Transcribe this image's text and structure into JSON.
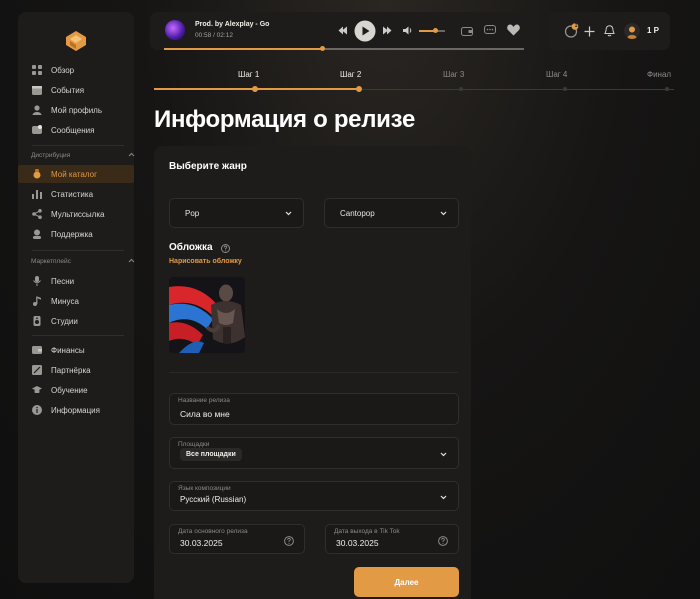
{
  "sidebar": {
    "main_items": [
      {
        "label": "Обзор",
        "icon": "grid-icon"
      },
      {
        "label": "События",
        "icon": "calendar-icon"
      },
      {
        "label": "Мой профиль",
        "icon": "user-icon"
      },
      {
        "label": "Сообщения",
        "icon": "message-icon"
      }
    ],
    "distribution": {
      "title": "Дистрибуция",
      "items": [
        {
          "label": "Мой каталог",
          "icon": "catalog-icon",
          "active": true
        },
        {
          "label": "Статистика",
          "icon": "stats-icon"
        },
        {
          "label": "Мультиссылка",
          "icon": "share-icon"
        },
        {
          "label": "Поддержка",
          "icon": "support-icon"
        }
      ]
    },
    "marketplace": {
      "title": "Маркетплейс",
      "items": [
        {
          "label": "Песни",
          "icon": "mic-icon"
        },
        {
          "label": "Минуса",
          "icon": "music-note-icon"
        },
        {
          "label": "Студии",
          "icon": "speaker-icon"
        }
      ]
    },
    "bottom_items": [
      {
        "label": "Финансы",
        "icon": "wallet-icon"
      },
      {
        "label": "Партнёрка",
        "icon": "partner-icon"
      },
      {
        "label": "Обучение",
        "icon": "education-icon"
      },
      {
        "label": "Информация",
        "icon": "info-icon"
      }
    ]
  },
  "player": {
    "track_title": "Prod. by Alexplay - Go",
    "time": "00:58 / 02:12",
    "progress": 0.44,
    "volume": 0.65
  },
  "top_right": {
    "notification_badge": "1",
    "balance": "1 Р"
  },
  "steps": [
    {
      "label": "Шаг 1",
      "state": "done"
    },
    {
      "label": "Шаг 2",
      "state": "current"
    },
    {
      "label": "Шаг 3",
      "state": "upcoming"
    },
    {
      "label": "Шаг 4",
      "state": "upcoming"
    },
    {
      "label": "Финал",
      "state": "upcoming"
    }
  ],
  "page_title": "Информация о релизе",
  "form": {
    "genre_heading": "Выберите жанр",
    "genre": "Pop",
    "subgenre": "Cantopop",
    "cover_heading": "Обложка",
    "draw_cover_link": "Нарисовать обложку",
    "release_name_label": "Название релиза",
    "release_name_value": "Сила во мне",
    "platforms_label": "Площадки",
    "platforms_value": "Все площадки",
    "language_label": "Язык композиции",
    "language_value": "Русский (Russian)",
    "release_date_label": "Дата основного релиза",
    "release_date_value": "30.03.2025",
    "tiktok_date_label": "Дата выхода в Tik Tok",
    "tiktok_date_value": "30.03.2025",
    "next_button": "Далее"
  },
  "colors": {
    "accent": "#e39a44",
    "panel": "#1d1c1b",
    "background": "#121212"
  }
}
